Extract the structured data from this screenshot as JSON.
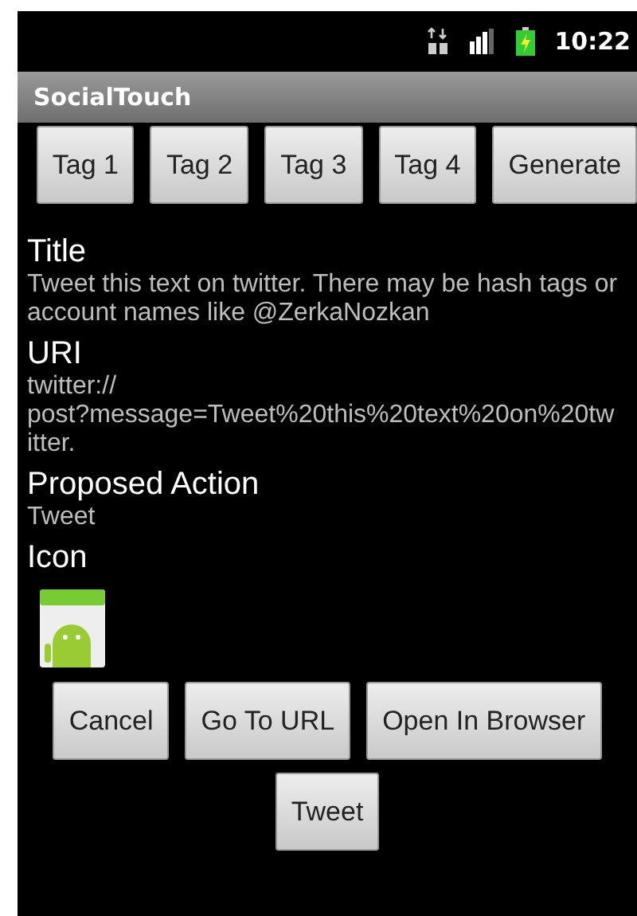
{
  "status_bar": {
    "time": "10:22"
  },
  "title_bar": {
    "title": "SocialTouch"
  },
  "tag_buttons": [
    "Tag 1",
    "Tag 2",
    "Tag 3",
    "Tag 4",
    "Generate"
  ],
  "sections": [
    {
      "heading": "Title",
      "lines": [
        "Tweet this text on twitter. There may be hash tags or account names like @ZerkaNozkan"
      ]
    },
    {
      "heading": "URI",
      "lines": [
        "twitter://",
        "post?message=Tweet%20this%20text%20on%20tw",
        "itter."
      ]
    },
    {
      "heading": "Proposed Action",
      "lines": [
        "Tweet"
      ]
    },
    {
      "heading": "Icon"
    }
  ],
  "action_buttons": [
    [
      "Cancel",
      "Go To URL",
      "Open In Browser"
    ],
    [
      "Tweet"
    ]
  ]
}
